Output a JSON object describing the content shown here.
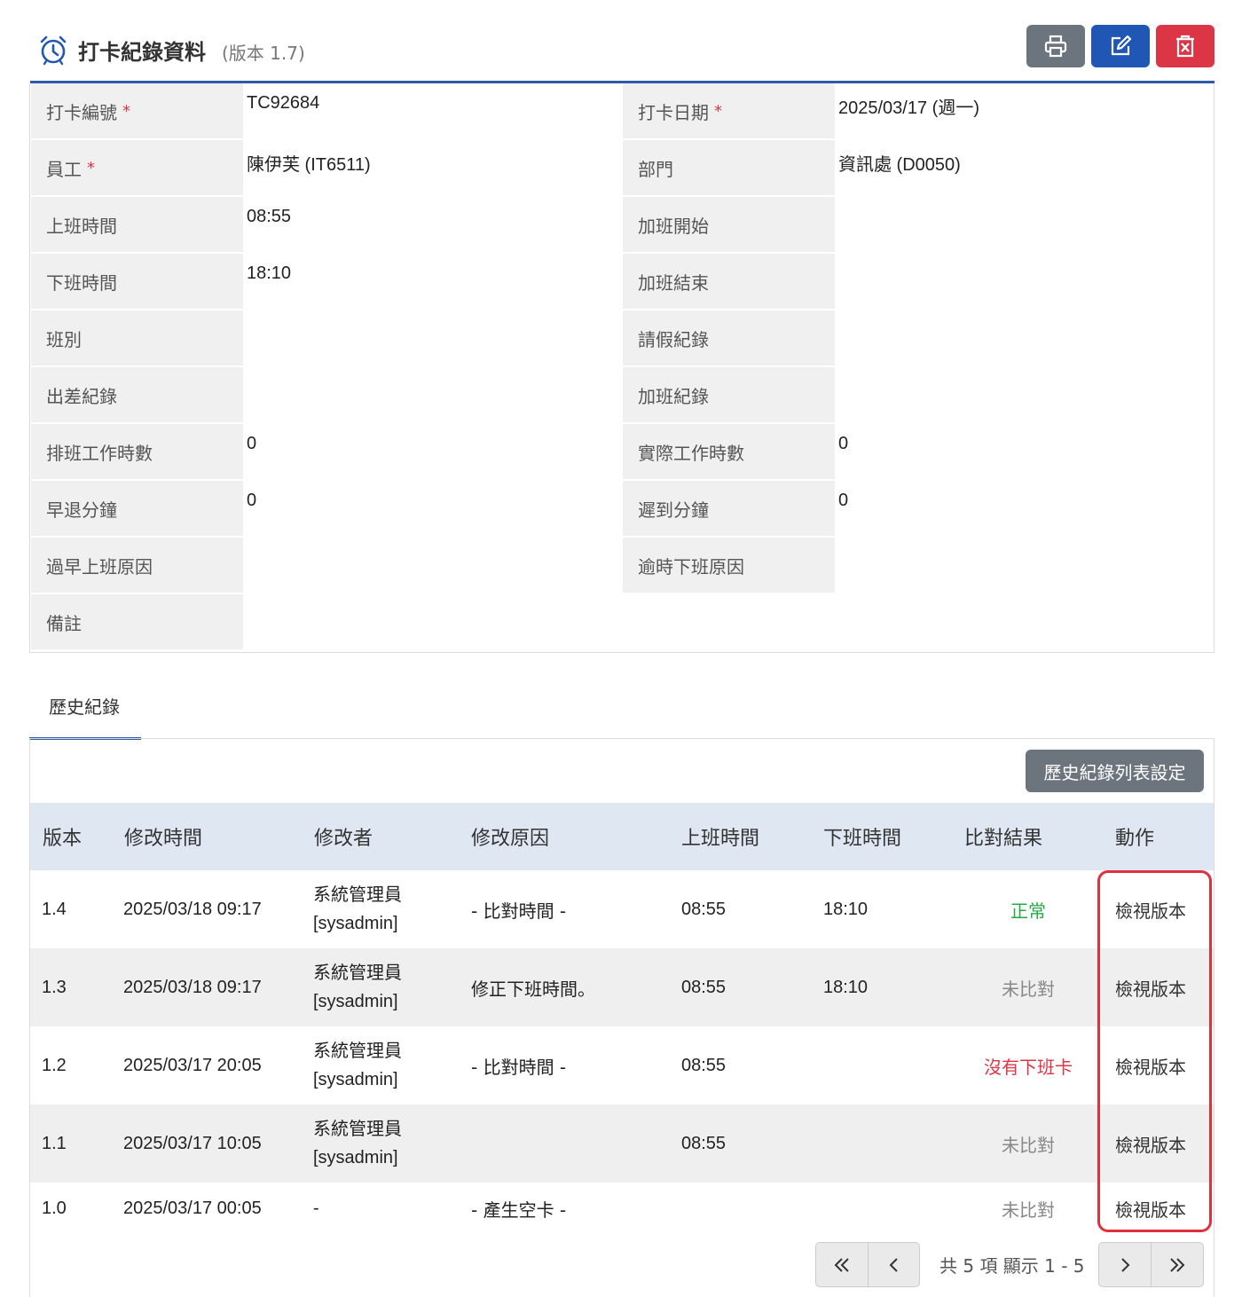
{
  "header": {
    "title": "打卡紀錄資料",
    "version": "(版本 1.7)",
    "icon": "alarm-clock-icon",
    "print_icon": "printer-icon",
    "edit_icon": "edit-icon",
    "delete_icon": "delete-icon"
  },
  "form": {
    "left": [
      {
        "label": "打卡編號",
        "required": "*",
        "value": "TC92684"
      },
      {
        "label": "員工",
        "required": "*",
        "value": "陳伊芙 (IT6511)"
      },
      {
        "label": "上班時間",
        "value": "08:55"
      },
      {
        "label": "下班時間",
        "value": "18:10"
      },
      {
        "label": "班別",
        "value": ""
      },
      {
        "label": "出差紀錄",
        "value": ""
      },
      {
        "label": "排班工作時數",
        "value": "0"
      },
      {
        "label": "早退分鐘",
        "value": "0"
      },
      {
        "label": "過早上班原因",
        "value": ""
      },
      {
        "label": "備註",
        "value": ""
      }
    ],
    "right": [
      {
        "label": "打卡日期",
        "required": "*",
        "value": "2025/03/17 (週一)"
      },
      {
        "label": "部門",
        "value": "資訊處 (D0050)"
      },
      {
        "label": "加班開始",
        "value": ""
      },
      {
        "label": "加班結束",
        "value": ""
      },
      {
        "label": "請假紀錄",
        "value": ""
      },
      {
        "label": "加班紀錄",
        "value": ""
      },
      {
        "label": "實際工作時數",
        "value": "0"
      },
      {
        "label": "遲到分鐘",
        "value": "0"
      },
      {
        "label": "逾時下班原因",
        "value": ""
      }
    ]
  },
  "history": {
    "tab_label": "歷史紀錄",
    "settings_button": "歷史紀錄列表設定",
    "columns": [
      "版本",
      "修改時間",
      "修改者",
      "修改原因",
      "上班時間",
      "下班時間",
      "比對結果",
      "動作"
    ],
    "rows": [
      {
        "version": "1.4",
        "time": "2025/03/18 09:17",
        "user": "系統管理員",
        "user_id": "[sysadmin]",
        "reason": "- 比對時間 -",
        "start": "08:55",
        "end": "18:10",
        "result": "正常",
        "result_status": "ok",
        "action": "檢視版本"
      },
      {
        "version": "1.3",
        "time": "2025/03/18 09:17",
        "user": "系統管理員",
        "user_id": "[sysadmin]",
        "reason": "修正下班時間。",
        "start": "08:55",
        "end": "18:10",
        "result": "未比對",
        "result_status": "none",
        "action": "檢視版本"
      },
      {
        "version": "1.2",
        "time": "2025/03/17 20:05",
        "user": "系統管理員",
        "user_id": "[sysadmin]",
        "reason": "- 比對時間 -",
        "start": "08:55",
        "end": "",
        "result": "沒有下班卡",
        "result_status": "bad",
        "action": "檢視版本"
      },
      {
        "version": "1.1",
        "time": "2025/03/17 10:05",
        "user": "系統管理員",
        "user_id": "[sysadmin]",
        "reason": "",
        "start": "08:55",
        "end": "",
        "result": "未比對",
        "result_status": "none",
        "action": "檢視版本"
      },
      {
        "version": "1.0",
        "time": "2025/03/17 00:05",
        "user": "-",
        "user_id": "",
        "reason": "- 產生空卡 -",
        "start": "",
        "end": "",
        "result": "未比對",
        "result_status": "none",
        "action": "檢視版本"
      }
    ]
  },
  "pagination": {
    "info": "共 5 項 顯示 1 - 5",
    "first_icon": "double-chevron-left-icon",
    "prev_icon": "chevron-left-icon",
    "next_icon": "chevron-right-icon",
    "last_icon": "double-chevron-right-icon"
  },
  "colors": {
    "accent": "#2f5aa8",
    "danger": "#dc3545",
    "success": "#28a745",
    "secondary": "#6c757d",
    "header_row": "#dfe7f3"
  }
}
